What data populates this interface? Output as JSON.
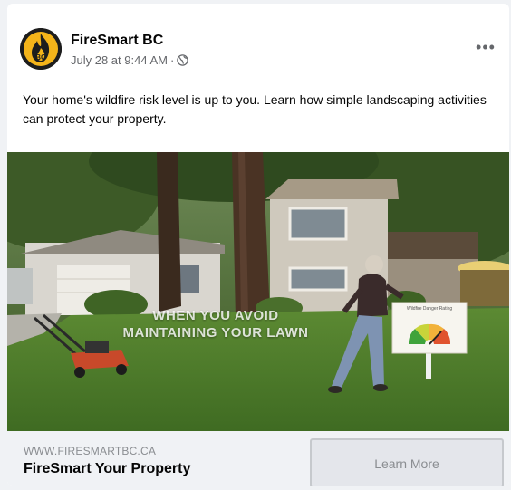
{
  "post": {
    "page_name": "FireSmart BC",
    "timestamp": "July 28 at 9:44 AM",
    "separator": "·",
    "audience_icon": "globe-icon",
    "more_label": "•••",
    "caption": "Your home's wildfire risk level is up to you. Learn how simple landscaping activities can protect your property.",
    "avatar_text": "BC",
    "avatar_icon": "flame-icon"
  },
  "media": {
    "overlay_line_1": "WHEN YOU AVOID",
    "overlay_line_2": "MAINTAINING YOUR LAWN",
    "sign_title": "Wildfire Danger Rating",
    "gauge_level": 0.72
  },
  "link": {
    "domain": "WWW.FIRESMARTBC.CA",
    "title": "FireSmart Your Property",
    "cta_label": "Learn More"
  },
  "colors": {
    "brand_yellow": "#f4b41a",
    "avatar_bg": "#1d1d1d",
    "meta_gray": "#65676b",
    "link_bar_bg": "#f0f2f5"
  }
}
